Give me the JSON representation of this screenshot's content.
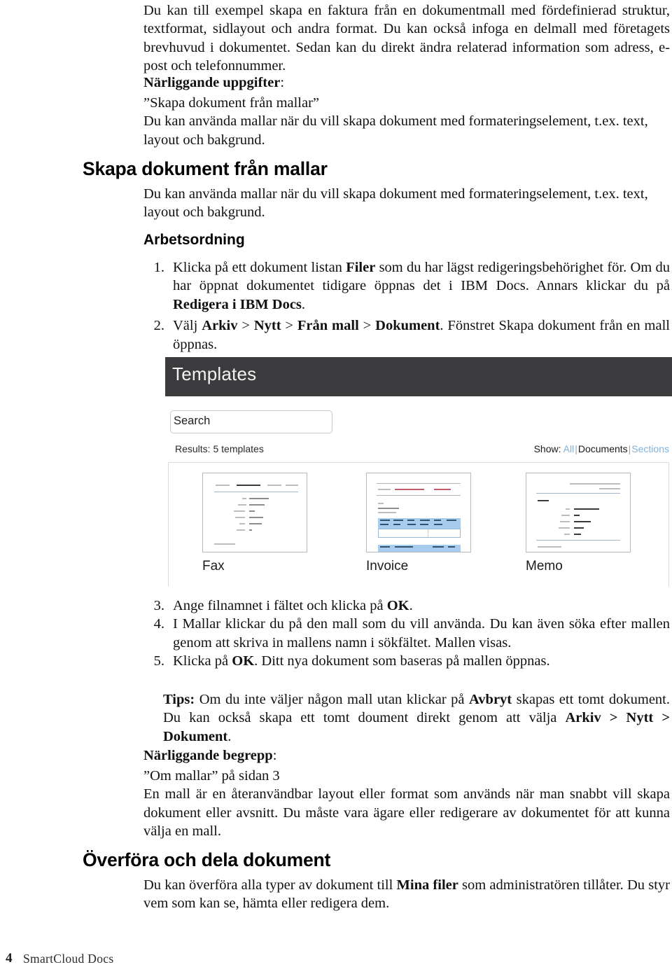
{
  "intro": {
    "paragraph": "Du kan till exempel skapa en faktura från en dokumentmall med fördefinierad struktur, textformat, sidlayout och andra format. Du kan också infoga en delmall med företagets brevhuvud i dokumentet. Sedan kan du direkt ändra relaterad information som adress, e-post och telefonnummer.",
    "related_tasks_label": "Närliggande uppgifter",
    "related_tasks_colon": ":",
    "related_link": "”Skapa dokument från mallar”",
    "related_desc": "Du kan använda mallar när du vill skapa dokument med formateringselement, t.ex. text, layout och bakgrund."
  },
  "section_templates": {
    "heading": "Skapa dokument från mallar",
    "intro": "Du kan använda mallar när du vill skapa dokument med formateringselement, t.ex. text, layout och bakgrund.",
    "procedure_heading": "Arbetsordning",
    "steps": [
      {
        "num": "1.",
        "parts": [
          {
            "t": "Klicka på ett dokument listan ",
            "b": false
          },
          {
            "t": "Filer",
            "b": true
          },
          {
            "t": " som du har lägst redigeringsbehörighet för. Om du har öppnat dokumentet tidigare öppnas det i IBM Docs. Annars klickar du på ",
            "b": false
          },
          {
            "t": "Redigera i IBM Docs",
            "b": true
          },
          {
            "t": ".",
            "b": false
          }
        ]
      },
      {
        "num": "2.",
        "parts": [
          {
            "t": "Välj ",
            "b": false
          },
          {
            "t": "Arkiv",
            "b": true
          },
          {
            "t": " > ",
            "b": false
          },
          {
            "t": "Nytt",
            "b": true
          },
          {
            "t": " > ",
            "b": false
          },
          {
            "t": "Från mall",
            "b": true
          },
          {
            "t": " > ",
            "b": false
          },
          {
            "t": "Dokument",
            "b": true
          },
          {
            "t": ". Fönstret Skapa dokument från en mall öppnas.",
            "b": false
          }
        ]
      },
      {
        "num": "3.",
        "parts": [
          {
            "t": "Ange filnamnet i fältet och klicka på ",
            "b": false
          },
          {
            "t": "OK",
            "b": true
          },
          {
            "t": ".",
            "b": false
          }
        ]
      },
      {
        "num": "4.",
        "parts": [
          {
            "t": "I Mallar klickar du på den mall som du vill använda. Du kan även söka efter mallen genom att skriva in mallens namn i sökfältet. Mallen visas.",
            "b": false
          }
        ]
      },
      {
        "num": "5.",
        "parts": [
          {
            "t": "Klicka på ",
            "b": false
          },
          {
            "t": "OK",
            "b": true
          },
          {
            "t": ". Ditt nya dokument som baseras på mallen öppnas.",
            "b": false
          }
        ]
      }
    ],
    "tip": {
      "parts": [
        {
          "t": "Tips:",
          "b": true
        },
        {
          "t": " Om du inte väljer någon mall utan klickar på ",
          "b": false
        },
        {
          "t": "Avbryt",
          "b": true
        },
        {
          "t": " skapas ett tomt dokument. Du kan också skapa ett tomt doument direkt genom att välja ",
          "b": false
        },
        {
          "t": "Arkiv > Nytt > Dokument",
          "b": true
        },
        {
          "t": ".",
          "b": false
        }
      ]
    },
    "related_concepts_label": "Närliggande begrepp",
    "related_concepts_colon": ":",
    "concept_link": "”Om mallar” på sidan 3",
    "concept_desc": "En mall är en återanvändbar layout eller format som används när man snabbt vill skapa dokument eller avsnitt. Du måste vara ägare eller redigerare av dokumentet för att kunna välja en mall."
  },
  "screenshot": {
    "title": "Templates",
    "search_value": "Search",
    "search_placeholder": "Search",
    "results_text": "Results: 5 templates",
    "show_label": "Show:",
    "show_all": "All",
    "show_documents": "Documents",
    "show_sections": "Sections",
    "separator": "|",
    "templates": [
      {
        "name": "Fax"
      },
      {
        "name": "Invoice"
      },
      {
        "name": "Memo"
      }
    ],
    "colors": {
      "titlebar": "#3b3b3d",
      "link": "#7fb2da",
      "table_header": "#a8cced"
    }
  },
  "section_upload": {
    "heading": "Överföra och dela dokument",
    "parts": [
      {
        "t": "Du kan överföra alla typer av dokument till ",
        "b": false
      },
      {
        "t": "Mina filer",
        "b": true
      },
      {
        "t": " som administratören tillåter. Du styr vem som kan se, hämta eller redigera dem.",
        "b": false
      }
    ]
  },
  "footer": {
    "page_number": "4",
    "book_title": "SmartCloud Docs"
  }
}
